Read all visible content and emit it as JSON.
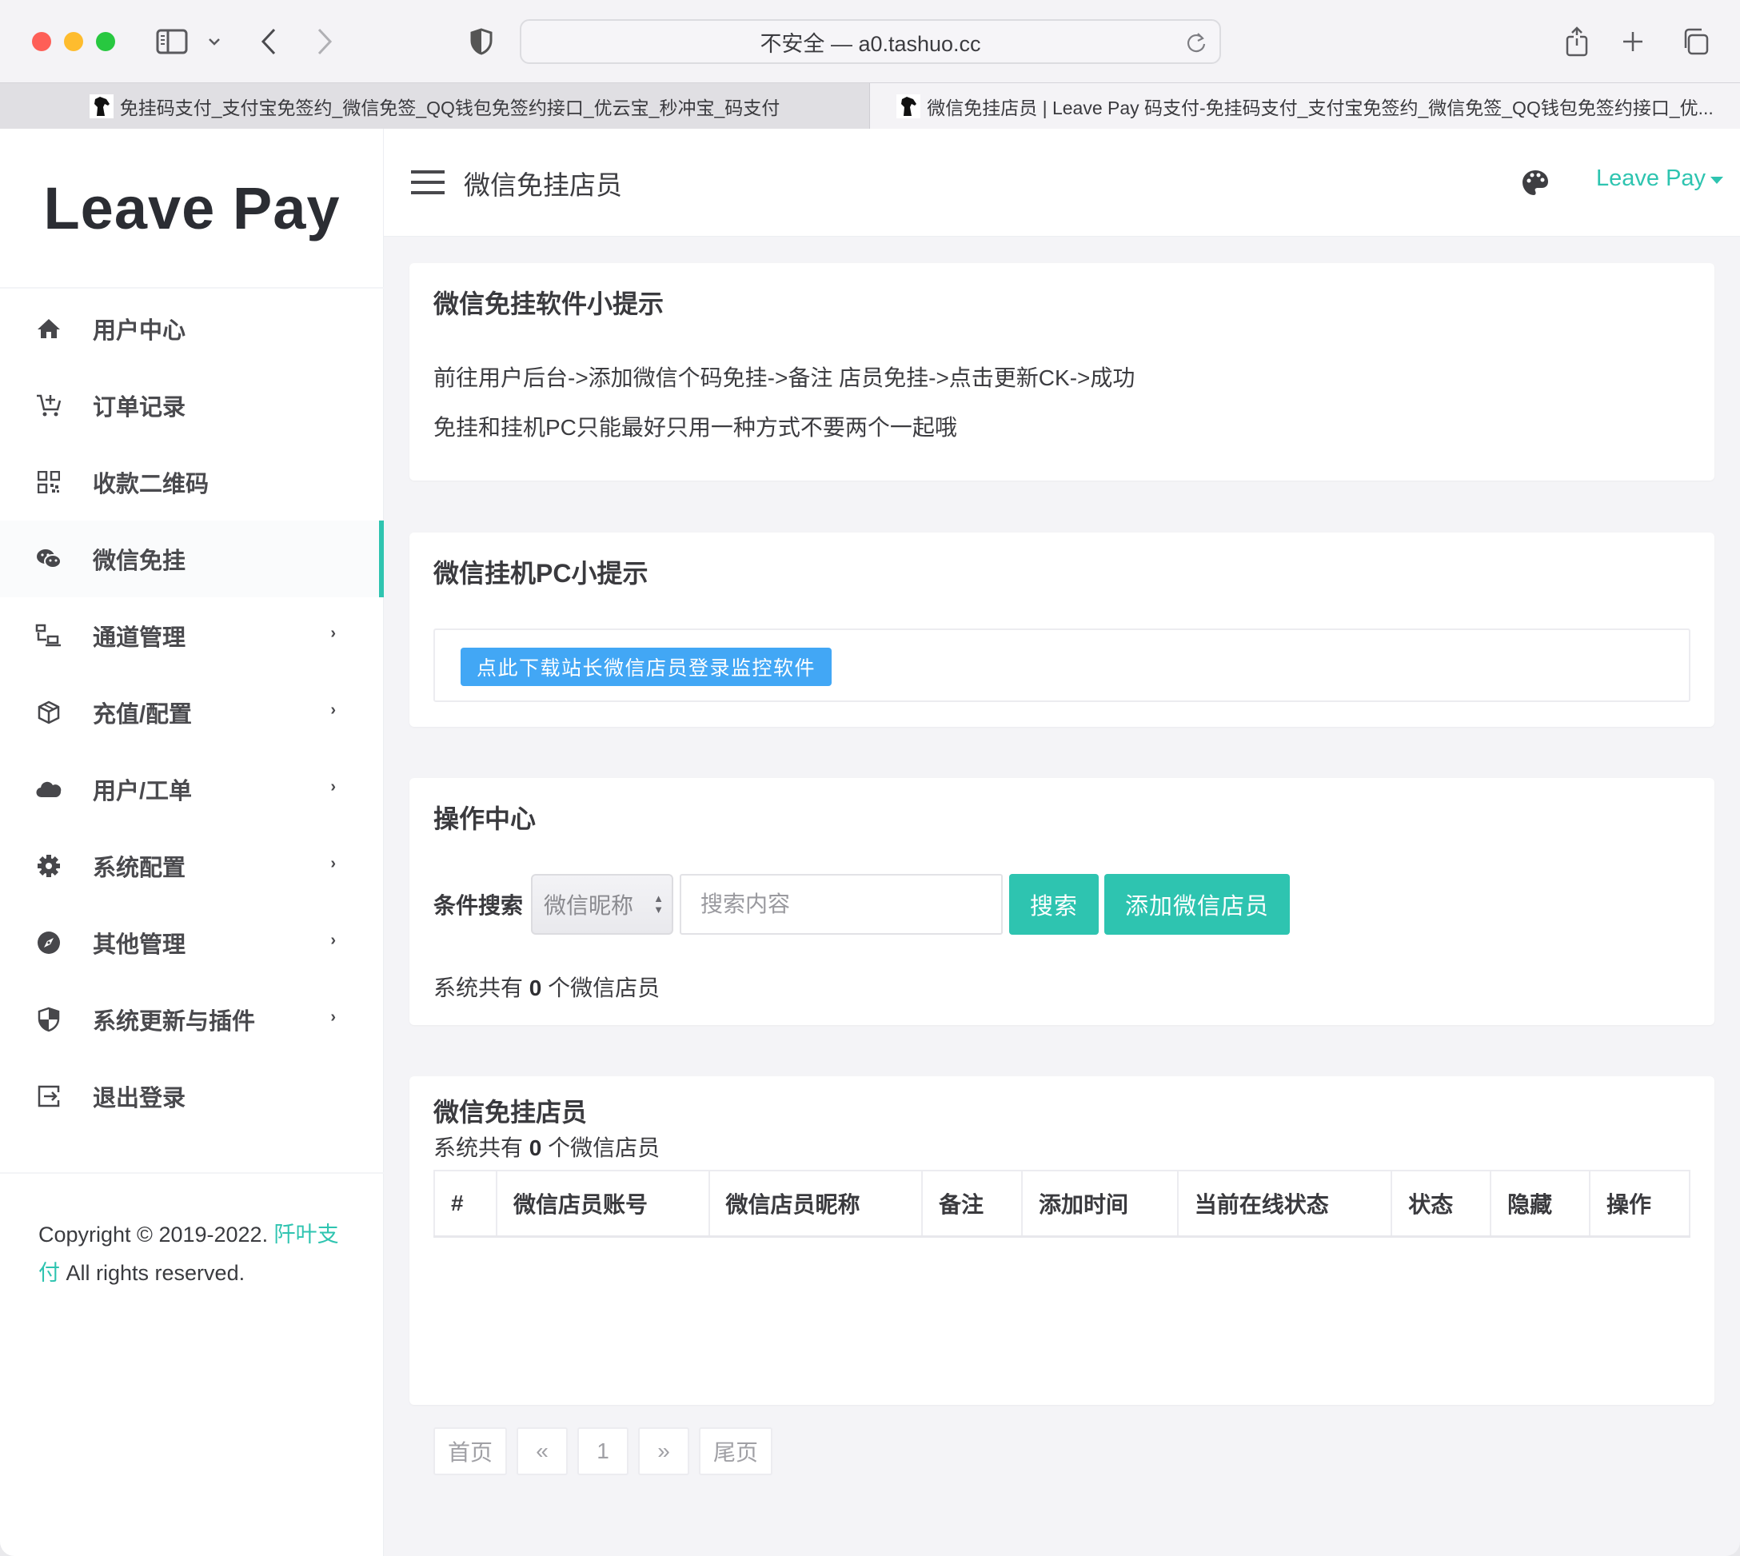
{
  "browser": {
    "address": "不安全 — a0.tashuo.cc",
    "icons": {
      "sidebar": "sidebar-icon",
      "back": "chevron-left-icon",
      "forward": "chevron-right-icon",
      "privacy": "shield-icon",
      "reload": "reload-icon",
      "share": "share-icon",
      "new_tab": "plus-icon",
      "tab_overview": "tabs-icon"
    },
    "tabs": [
      {
        "title": "免挂码支付_支付宝免签约_微信免签_QQ钱包免签约接口_优云宝_秒冲宝_码支付",
        "active": false
      },
      {
        "title": "微信免挂店员 | Leave Pay 码支付-免挂码支付_支付宝免签约_微信免签_QQ钱包免签约接口_优...",
        "active": true
      }
    ]
  },
  "sidebar": {
    "logo": "Leave Pay",
    "items": [
      {
        "label": "用户中心",
        "icon": "home-icon",
        "active": false,
        "has_children": false
      },
      {
        "label": "订单记录",
        "icon": "cart-plus-icon",
        "active": false,
        "has_children": false
      },
      {
        "label": "收款二维码",
        "icon": "qrcode-icon",
        "active": false,
        "has_children": false
      },
      {
        "label": "微信免挂",
        "icon": "wechat-icon",
        "active": true,
        "has_children": false
      },
      {
        "label": "通道管理",
        "icon": "network-icon",
        "active": false,
        "has_children": true
      },
      {
        "label": "充值/配置",
        "icon": "cube-icon",
        "active": false,
        "has_children": true
      },
      {
        "label": "用户/工单",
        "icon": "cloud-icon",
        "active": false,
        "has_children": true
      },
      {
        "label": "系统配置",
        "icon": "gear-icon",
        "active": false,
        "has_children": true
      },
      {
        "label": "其他管理",
        "icon": "compass-icon",
        "active": false,
        "has_children": true
      },
      {
        "label": "系统更新与插件",
        "icon": "shield-half-icon",
        "active": false,
        "has_children": true
      },
      {
        "label": "退出登录",
        "icon": "logout-icon",
        "active": false,
        "has_children": false
      }
    ],
    "chevron": "›",
    "footer": {
      "prefix": "Copyright © 2019-2022. ",
      "link": "阡叶支付",
      "suffix": " All rights reserved."
    }
  },
  "header": {
    "title": "微信免挂店员",
    "user": "Leave Pay",
    "theme_icon": "palette-icon"
  },
  "cards": {
    "tips": {
      "title": "微信免挂软件小提示",
      "lines": [
        "前往用户后台->添加微信个码免挂->备注 店员免挂->点击更新CK->成功",
        "免挂和挂机PC只能最好只用一种方式不要两个一起哦"
      ]
    },
    "pc": {
      "title": "微信挂机PC小提示",
      "download_label": "点此下载站长微信店员登录监控软件"
    },
    "ops": {
      "title": "操作中心",
      "search_label": "条件搜索",
      "select_value": "微信昵称",
      "search_placeholder": "搜索内容",
      "search_value": "",
      "search_button": "搜索",
      "add_button": "添加微信店员",
      "count_prefix": "系统共有 ",
      "count": "0",
      "count_suffix": " 个微信店员"
    },
    "list": {
      "title": "微信免挂店员",
      "count_prefix": "系统共有 ",
      "count": "0",
      "count_suffix": " 个微信店员",
      "columns": [
        "#",
        "微信店员账号",
        "微信店员昵称",
        "备注",
        "添加时间",
        "当前在线状态",
        "状态",
        "隐藏",
        "操作"
      ],
      "rows": [],
      "pagination": [
        "首页",
        "«",
        "1",
        "»",
        "尾页"
      ]
    }
  },
  "colors": {
    "accent": "#2ec4b0",
    "download_button": "#42a7f5",
    "page_bg": "#f4f4f7"
  }
}
